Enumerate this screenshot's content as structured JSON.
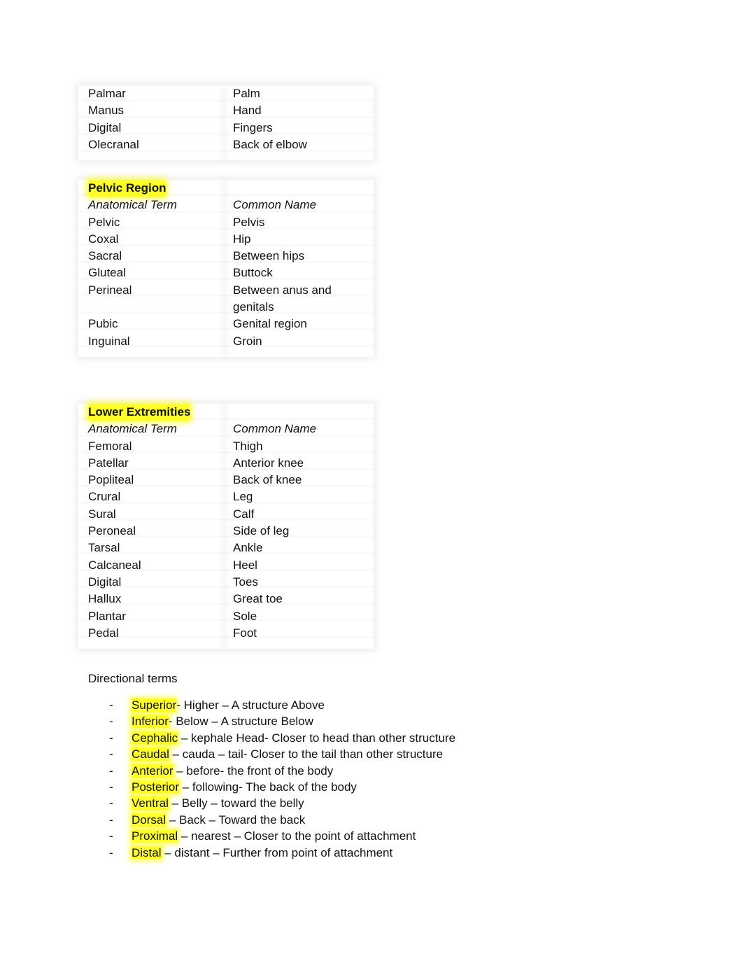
{
  "upper_table": {
    "rows": [
      {
        "term": "Palmar",
        "common": "Palm"
      },
      {
        "term": "Manus",
        "common": "Hand"
      },
      {
        "term": "Digital",
        "common": "Fingers"
      },
      {
        "term": "Olecranal",
        "common": "Back of elbow"
      }
    ]
  },
  "pelvic_table": {
    "title": "Pelvic Region",
    "header": {
      "term": "Anatomical Term",
      "common": "Common Name"
    },
    "rows": [
      {
        "term": "Pelvic",
        "common": "Pelvis"
      },
      {
        "term": "Coxal",
        "common": "Hip"
      },
      {
        "term": "Sacral",
        "common": "Between hips"
      },
      {
        "term": "Gluteal",
        "common": "Buttock"
      },
      {
        "term": "Perineal",
        "common": "Between anus and genitals"
      },
      {
        "term": "Pubic",
        "common": "Genital region"
      },
      {
        "term": "Inguinal",
        "common": "Groin"
      }
    ]
  },
  "lower_table": {
    "title": "Lower Extremities",
    "header": {
      "term": "Anatomical Term",
      "common": "Common Name"
    },
    "rows": [
      {
        "term": "Femoral",
        "common": "Thigh"
      },
      {
        "term": "Patellar",
        "common": "Anterior knee"
      },
      {
        "term": "Popliteal",
        "common": "Back of knee"
      },
      {
        "term": "Crural",
        "common": "Leg"
      },
      {
        "term": "Sural",
        "common": "Calf"
      },
      {
        "term": "Peroneal",
        "common": "Side of leg"
      },
      {
        "term": "Tarsal",
        "common": "Ankle"
      },
      {
        "term": "Calcaneal",
        "common": "Heel"
      },
      {
        "term": "Digital",
        "common": "Toes"
      },
      {
        "term": "Hallux",
        "common": "Great toe"
      },
      {
        "term": "Plantar",
        "common": "Sole"
      },
      {
        "term": "Pedal",
        "common": "Foot"
      }
    ]
  },
  "directional": {
    "title": "Directional terms",
    "bullet": "-",
    "highlight_color": "#ffff2a",
    "items": [
      {
        "term": "Superior",
        "rest": "- Higher – A structure Above"
      },
      {
        "term": "Inferior",
        "rest": "- Below – A structure Below"
      },
      {
        "term": "Cephalic",
        "rest": " – kephale Head- Closer to head than other structure"
      },
      {
        "term": "Caudal",
        "rest": " – cauda – tail- Closer to the tail than other structure"
      },
      {
        "term": "Anterior",
        "rest": " – before- the front of the body"
      },
      {
        "term": "Posterior",
        "rest": " – following- The back of the body"
      },
      {
        "term": "Ventral",
        "rest": " – Belly – toward the belly"
      },
      {
        "term": "Dorsal",
        "rest": " – Back – Toward the back"
      },
      {
        "term": "Proximal",
        "rest": " – nearest – Closer to the point of attachment"
      },
      {
        "term": "Distal",
        "rest": " – distant – Further from point of attachment"
      }
    ]
  }
}
